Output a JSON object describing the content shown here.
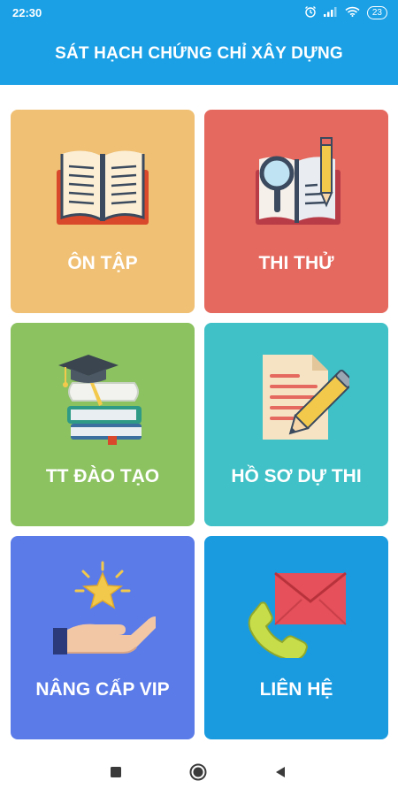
{
  "status_bar": {
    "time": "22:30",
    "battery": "23",
    "icons": [
      "alarm-icon",
      "signal-icon",
      "wifi-icon",
      "battery-icon"
    ]
  },
  "app_bar": {
    "title": "SÁT HẠCH CHỨNG CHỈ XÂY DỰNG",
    "color": "#1ba0e6"
  },
  "tiles": [
    {
      "label": "ÔN TẬP",
      "color": "#f0c074",
      "icon": "open-book-icon"
    },
    {
      "label": "THI THỬ",
      "color": "#e5695e",
      "icon": "magnifier-book-pencil-icon"
    },
    {
      "label": "TT ĐÀO TẠO",
      "color": "#8cc260",
      "icon": "graduation-books-icon"
    },
    {
      "label": "HỒ SƠ DỰ THI",
      "color": "#3fc1c7",
      "icon": "document-pencil-icon"
    },
    {
      "label": "NÂNG CẤP VIP",
      "color": "#5b7be8",
      "icon": "hand-star-icon"
    },
    {
      "label": "LIÊN HỆ",
      "color": "#1a9be0",
      "icon": "phone-envelope-icon"
    }
  ],
  "nav_bar": {
    "buttons": [
      "recents-square-icon",
      "home-circle-icon",
      "back-triangle-icon"
    ]
  }
}
